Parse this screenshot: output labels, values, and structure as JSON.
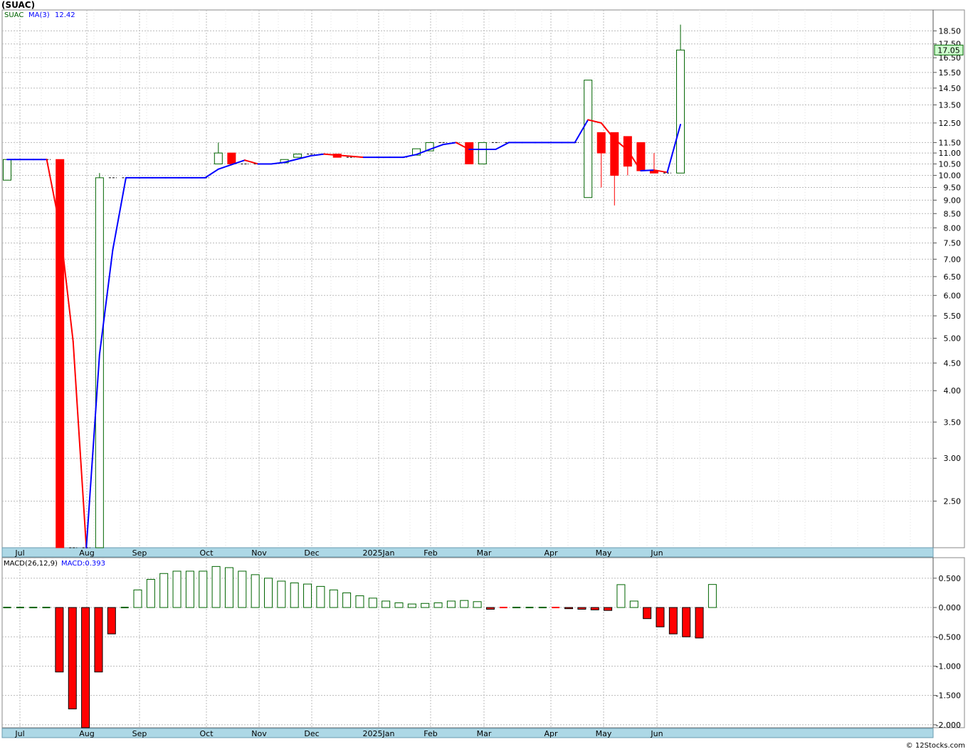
{
  "title": "(SUAC)",
  "legend": {
    "symbol": "SUAC",
    "ma_label": "MA(3)",
    "ma_value": "12.42"
  },
  "last_price": "17.05",
  "macd_label": "MACD(26,12,9)",
  "macd_value_label": "MACD:0.393",
  "watermark": "© 12Stocks.com",
  "colors": {
    "up": "#006400",
    "down": "#ff0000",
    "ma_rising": "#0000ff",
    "ma_falling": "#ff0000",
    "axis_band": "#add8e6"
  },
  "month_labels": [
    "Jul",
    "Aug",
    "Sep",
    "Oct",
    "Nov",
    "Dec",
    "2025Jan",
    "Feb",
    "Mar",
    "Apr",
    "May",
    "Jun"
  ],
  "chart_data": [
    {
      "type": "candlestick",
      "name": "SUAC",
      "y_scale": "log",
      "ylim": [
        2.05,
        19.5
      ],
      "y_ticks": [
        "18.50",
        "17.50",
        "16.50",
        "15.50",
        "14.50",
        "13.50",
        "12.50",
        "11.50",
        "11.00",
        "10.50",
        "10.00",
        "9.50",
        "9.00",
        "8.50",
        "8.00",
        "7.50",
        "7.00",
        "6.50",
        "6.00",
        "5.50",
        "5.00",
        "4.50",
        "4.00",
        "3.50",
        "3.00",
        "2.50"
      ],
      "candles": [
        {
          "o": 9.8,
          "h": 10.7,
          "l": 9.8,
          "c": 10.7
        },
        {
          "o": 10.7,
          "h": 10.7,
          "l": 10.7,
          "c": 10.7
        },
        {
          "o": 10.7,
          "h": 10.7,
          "l": 10.7,
          "c": 10.7
        },
        {
          "o": 10.7,
          "h": 10.7,
          "l": 10.7,
          "c": 10.7
        },
        {
          "o": 10.7,
          "h": 10.7,
          "l": 2.05,
          "c": 2.05
        },
        {
          "o": 2.05,
          "h": 2.05,
          "l": 2.05,
          "c": 2.05
        },
        {
          "o": 2.05,
          "h": 2.05,
          "l": 2.05,
          "c": 2.05
        },
        {
          "o": 2.05,
          "h": 10.1,
          "l": 2.05,
          "c": 9.9
        },
        {
          "o": 9.9,
          "h": 9.9,
          "l": 9.9,
          "c": 9.9
        },
        {
          "o": 9.9,
          "h": 9.9,
          "l": 9.9,
          "c": 9.9
        },
        {
          "o": 9.9,
          "h": 9.9,
          "l": 9.9,
          "c": 9.9
        },
        {
          "o": 9.9,
          "h": 9.9,
          "l": 9.9,
          "c": 9.9
        },
        {
          "o": 9.9,
          "h": 9.9,
          "l": 9.9,
          "c": 9.9
        },
        {
          "o": 9.9,
          "h": 9.9,
          "l": 9.9,
          "c": 9.9
        },
        {
          "o": 9.9,
          "h": 9.9,
          "l": 9.9,
          "c": 9.9
        },
        {
          "o": 9.9,
          "h": 9.9,
          "l": 9.9,
          "c": 9.9
        },
        {
          "o": 10.5,
          "h": 11.5,
          "l": 10.5,
          "c": 11.0
        },
        {
          "o": 11.0,
          "h": 11.0,
          "l": 10.5,
          "c": 10.5
        },
        {
          "o": 10.5,
          "h": 10.5,
          "l": 10.5,
          "c": 10.5
        },
        {
          "o": 10.5,
          "h": 10.5,
          "l": 10.5,
          "c": 10.5
        },
        {
          "o": 10.5,
          "h": 10.5,
          "l": 10.5,
          "c": 10.5
        },
        {
          "o": 10.55,
          "h": 10.7,
          "l": 10.55,
          "c": 10.7
        },
        {
          "o": 10.8,
          "h": 10.95,
          "l": 10.8,
          "c": 10.95
        },
        {
          "o": 10.95,
          "h": 10.95,
          "l": 10.95,
          "c": 10.95
        },
        {
          "o": 10.95,
          "h": 10.95,
          "l": 10.95,
          "c": 10.95
        },
        {
          "o": 10.95,
          "h": 10.95,
          "l": 10.8,
          "c": 10.8
        },
        {
          "o": 10.8,
          "h": 10.8,
          "l": 10.8,
          "c": 10.8
        },
        {
          "o": 10.8,
          "h": 10.8,
          "l": 10.8,
          "c": 10.8
        },
        {
          "o": 10.8,
          "h": 10.8,
          "l": 10.8,
          "c": 10.8
        },
        {
          "o": 10.8,
          "h": 10.8,
          "l": 10.8,
          "c": 10.8
        },
        {
          "o": 10.8,
          "h": 10.8,
          "l": 10.8,
          "c": 10.8
        },
        {
          "o": 10.9,
          "h": 11.2,
          "l": 10.9,
          "c": 11.2
        },
        {
          "o": 11.1,
          "h": 11.5,
          "l": 11.1,
          "c": 11.5
        },
        {
          "o": 11.5,
          "h": 11.5,
          "l": 11.5,
          "c": 11.5
        },
        {
          "o": 11.5,
          "h": 11.5,
          "l": 11.5,
          "c": 11.5
        },
        {
          "o": 11.5,
          "h": 11.5,
          "l": 10.5,
          "c": 10.5
        },
        {
          "o": 10.5,
          "h": 11.5,
          "l": 10.5,
          "c": 11.5
        },
        {
          "o": 11.5,
          "h": 11.5,
          "l": 11.5,
          "c": 11.5
        },
        {
          "o": 11.5,
          "h": 11.5,
          "l": 11.5,
          "c": 11.5
        },
        {
          "o": 11.5,
          "h": 11.5,
          "l": 11.5,
          "c": 11.5
        },
        {
          "o": 11.5,
          "h": 11.5,
          "l": 11.5,
          "c": 11.5
        },
        {
          "o": 11.5,
          "h": 11.5,
          "l": 11.5,
          "c": 11.5
        },
        {
          "o": 11.5,
          "h": 11.5,
          "l": 11.5,
          "c": 11.5
        },
        {
          "o": 11.5,
          "h": 11.5,
          "l": 11.5,
          "c": 11.5
        },
        {
          "o": 9.1,
          "h": 15.0,
          "l": 9.1,
          "c": 15.0
        },
        {
          "o": 12.0,
          "h": 12.0,
          "l": 9.5,
          "c": 11.0
        },
        {
          "o": 12.0,
          "h": 12.0,
          "l": 8.8,
          "c": 10.0
        },
        {
          "o": 11.8,
          "h": 11.8,
          "l": 10.0,
          "c": 10.4
        },
        {
          "o": 11.5,
          "h": 11.5,
          "l": 10.2,
          "c": 10.2
        },
        {
          "o": 10.2,
          "h": 11.0,
          "l": 10.1,
          "c": 10.1
        },
        {
          "o": 10.1,
          "h": 10.1,
          "l": 10.1,
          "c": 10.1
        },
        {
          "o": 10.1,
          "h": 19.0,
          "l": 10.1,
          "c": 17.05
        }
      ],
      "ma3": [
        10.7,
        10.7,
        10.7,
        10.7,
        8.03,
        4.93,
        2.05,
        4.67,
        7.28,
        9.9,
        9.9,
        9.9,
        9.9,
        9.9,
        9.9,
        9.9,
        10.27,
        10.47,
        10.67,
        10.5,
        10.5,
        10.57,
        10.72,
        10.87,
        10.95,
        10.9,
        10.85,
        10.8,
        10.8,
        10.8,
        10.8,
        10.93,
        11.17,
        11.4,
        11.5,
        11.17,
        11.17,
        11.17,
        11.5,
        11.5,
        11.5,
        11.5,
        11.5,
        11.5,
        12.67,
        12.5,
        11.67,
        11.13,
        10.2,
        10.23,
        10.13,
        12.42
      ]
    },
    {
      "type": "bar",
      "name": "MACD(26,12,9)",
      "ylim": [
        -2.05,
        0.85
      ],
      "y_ticks": [
        "0.500",
        "0.000",
        "-0.500",
        "-1.000",
        "-1.500",
        "-2.000"
      ],
      "values": [
        0,
        0,
        0,
        0,
        -1.1,
        -1.73,
        -2.05,
        -1.1,
        -0.45,
        0,
        0.3,
        0.48,
        0.58,
        0.62,
        0.62,
        0.62,
        0.7,
        0.68,
        0.62,
        0.56,
        0.5,
        0.45,
        0.42,
        0.4,
        0.36,
        0.3,
        0.25,
        0.2,
        0.16,
        0.11,
        0.08,
        0.06,
        0.07,
        0.08,
        0.11,
        0.12,
        0.1,
        -0.03,
        -0.01,
        0.01,
        0.01,
        0.01,
        -0.01,
        -0.02,
        -0.03,
        -0.04,
        -0.05,
        0.39,
        0.11,
        -0.19,
        -0.33,
        -0.45,
        -0.5,
        -0.52,
        0.393
      ]
    }
  ]
}
